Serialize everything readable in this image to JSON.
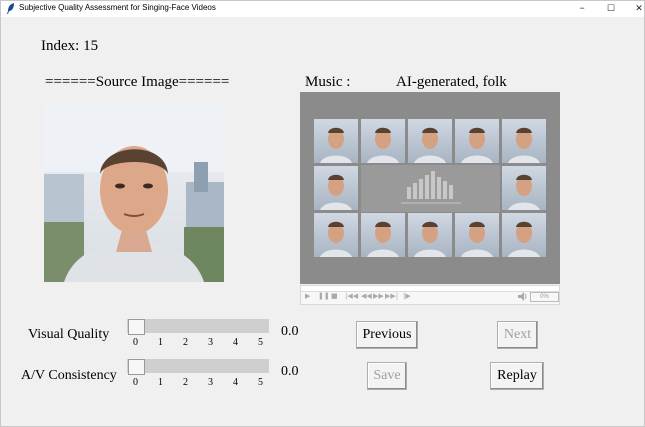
{
  "window": {
    "title": "Subjective Quality Assessment for Singing-Face Videos",
    "minimize_glyph": "−",
    "maximize_glyph": "☐",
    "close_glyph": "✕"
  },
  "index_label": "Index: 15",
  "source_image_label": "======Source Image======",
  "music_label": "Music :",
  "music_value": "AI-generated, folk",
  "player": {
    "volume_text": "0%",
    "controls": [
      "▶",
      "❚❚",
      "■",
      "|◀◀",
      "◀◀",
      "▶▶",
      "▶▶|",
      "|▶"
    ]
  },
  "visual_quality": {
    "label": "Visual Quality",
    "value": "0.0",
    "level": 0.0,
    "ticks": [
      "0",
      "1",
      "2",
      "3",
      "4",
      "5"
    ]
  },
  "av_consistency": {
    "label": "A/V Consistency",
    "value": "0.0",
    "level": 0.0,
    "ticks": [
      "0",
      "1",
      "2",
      "3",
      "4",
      "5"
    ]
  },
  "buttons": {
    "previous": "Previous",
    "next": "Next",
    "save": "Save",
    "replay": "Replay"
  }
}
